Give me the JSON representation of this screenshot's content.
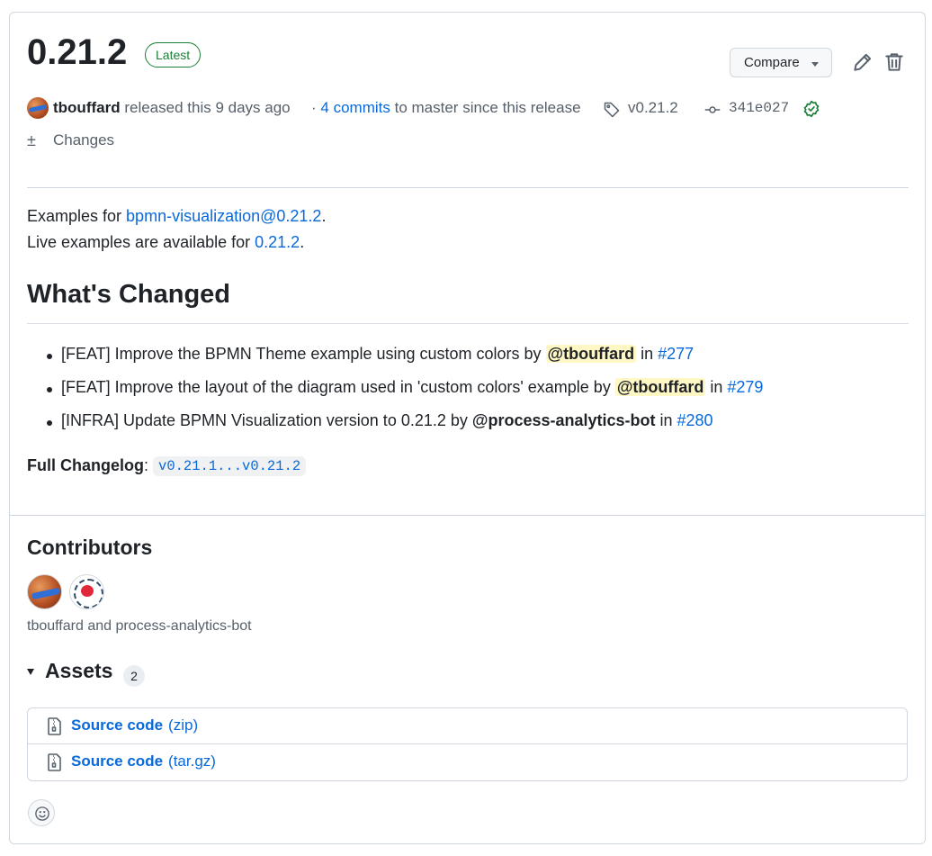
{
  "release": {
    "title": "0.21.2",
    "badge": "Latest",
    "compare_label": "Compare"
  },
  "meta": {
    "author": "tbouffard",
    "released_text": "released this 9 days ago",
    "commits_prefix": "·",
    "commits_link": "4 commits",
    "commits_suffix": "to master since this release",
    "tag": "v0.21.2",
    "commit_sha": "341e027",
    "changes_label": "Changes"
  },
  "body": {
    "p1_prefix": "Examples for ",
    "p1_link": "bpmn-visualization@0.21.2",
    "p1_suffix": ".",
    "p2_prefix": "Live examples are available for ",
    "p2_link": "0.21.2",
    "p2_suffix": ".",
    "heading": "What's Changed",
    "items": [
      {
        "text": "[FEAT] Improve the BPMN Theme example using custom colors by ",
        "mention": "@tbouffard",
        "in": " in ",
        "pr": "#277"
      },
      {
        "text": "[FEAT] Improve the layout of the diagram used in 'custom colors' example by ",
        "mention": "@tbouffard",
        "in": " in ",
        "pr": "#279"
      },
      {
        "text": "[INFRA] Update BPMN Visualization version to 0.21.2 by ",
        "mention": "@process-analytics-bot",
        "in": " in ",
        "pr": "#280"
      }
    ],
    "full_changelog_label": "Full Changelog",
    "full_changelog_sep": ": ",
    "full_changelog_link": "v0.21.1...v0.21.2"
  },
  "contributors": {
    "title": "Contributors",
    "names": "tbouffard and process-analytics-bot"
  },
  "assets": {
    "title": "Assets",
    "count": "2",
    "items": [
      {
        "name": "Source code",
        "ext": "(zip)"
      },
      {
        "name": "Source code",
        "ext": "(tar.gz)"
      }
    ]
  },
  "icons": {
    "edit": "pencil-icon",
    "delete": "trash-icon",
    "tag": "tag-icon",
    "commit": "git-commit-icon",
    "verified": "verified-check-icon",
    "diff": "diff-icon",
    "zip": "file-zip-icon",
    "react": "smiley-icon"
  },
  "colors": {
    "link": "#0969da",
    "success": "#1a7f37",
    "mention_highlight": "#fff8c5"
  }
}
